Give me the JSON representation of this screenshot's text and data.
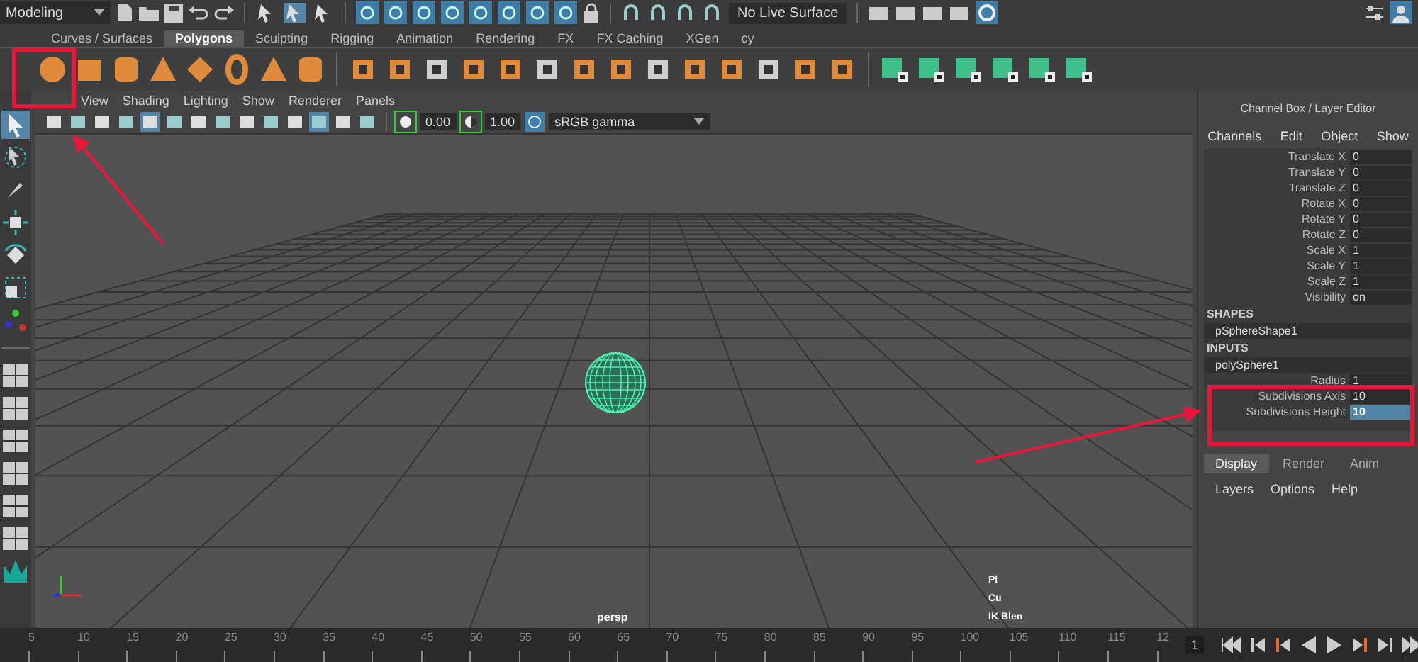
{
  "workspace_menu": {
    "value": "Modeling"
  },
  "live_surface": {
    "value": "No Live Surface"
  },
  "shelf_tabs": [
    {
      "label": "Curves / Surfaces",
      "selected": false
    },
    {
      "label": "Polygons",
      "selected": true
    },
    {
      "label": "Sculpting",
      "selected": false
    },
    {
      "label": "Rigging",
      "selected": false
    },
    {
      "label": "Animation",
      "selected": false
    },
    {
      "label": "Rendering",
      "selected": false
    },
    {
      "label": "FX",
      "selected": false
    },
    {
      "label": "FX Caching",
      "selected": false
    },
    {
      "label": "XGen",
      "selected": false
    },
    {
      "label": "cy",
      "selected": false
    }
  ],
  "viewport": {
    "menu": [
      "View",
      "Shading",
      "Lighting",
      "Show",
      "Renderer",
      "Panels"
    ],
    "exposure": "0.00",
    "gamma": "1.00",
    "color_space": "sRGB gamma",
    "camera": "persp",
    "hud": [
      "Pl",
      "Cu",
      "IK Blen"
    ]
  },
  "channel_box": {
    "title": "Channel Box / Layer Editor",
    "menu": [
      "Channels",
      "Edit",
      "Object",
      "Show"
    ],
    "channels": [
      {
        "label": "Translate X",
        "value": "0"
      },
      {
        "label": "Translate Y",
        "value": "0"
      },
      {
        "label": "Translate Z",
        "value": "0"
      },
      {
        "label": "Rotate X",
        "value": "0"
      },
      {
        "label": "Rotate Y",
        "value": "0"
      },
      {
        "label": "Rotate Z",
        "value": "0"
      },
      {
        "label": "Scale X",
        "value": "1"
      },
      {
        "label": "Scale Y",
        "value": "1"
      },
      {
        "label": "Scale Z",
        "value": "1"
      },
      {
        "label": "Visibility",
        "value": "on"
      }
    ],
    "shapes_header": "SHAPES",
    "shape": "pSphereShape1",
    "inputs_header": "INPUTS",
    "input_node": "polySphere1",
    "inputs": [
      {
        "label": "Radius",
        "value": "1",
        "selected": false
      },
      {
        "label": "Subdivisions Axis",
        "value": "10",
        "selected": false
      },
      {
        "label": "Subdivisions Height",
        "value": "10",
        "selected": true
      }
    ]
  },
  "layer_editor": {
    "tabs": [
      {
        "label": "Display",
        "selected": true
      },
      {
        "label": "Render",
        "selected": false
      },
      {
        "label": "Anim",
        "selected": false
      }
    ],
    "menu": [
      "Layers",
      "Options",
      "Help"
    ]
  },
  "timeline": {
    "ticks": [
      "5",
      "10",
      "15",
      "20",
      "25",
      "30",
      "35",
      "40",
      "45",
      "50",
      "55",
      "60",
      "65",
      "70",
      "75",
      "80",
      "85",
      "90",
      "95",
      "100",
      "105",
      "110",
      "115",
      "12"
    ],
    "current_frame": "1"
  }
}
